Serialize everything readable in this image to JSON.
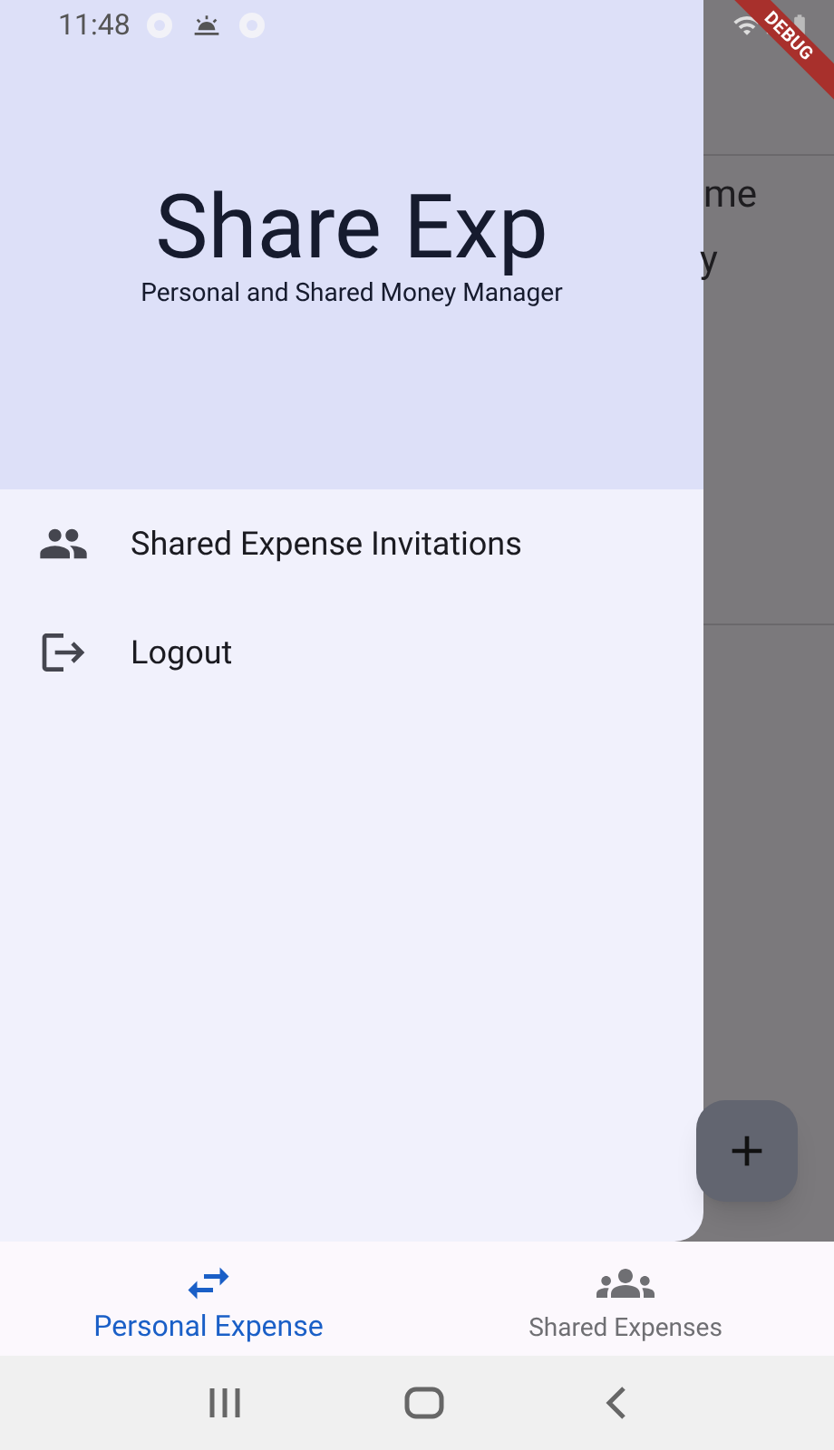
{
  "status_bar": {
    "time": "11:48"
  },
  "debug_banner": "DEBUG",
  "drawer": {
    "title": "Share Exp",
    "subtitle": "Personal and Shared Money Manager",
    "items": [
      {
        "label": "Shared Expense Invitations",
        "kind": "group"
      },
      {
        "label": "Logout",
        "kind": "logout"
      }
    ]
  },
  "background": {
    "texts": [
      "me",
      "y"
    ]
  },
  "bottom_nav": [
    {
      "label": "Personal Expense",
      "selected": true,
      "kind": "swap"
    },
    {
      "label": "Shared Expenses",
      "selected": false,
      "kind": "group"
    }
  ]
}
